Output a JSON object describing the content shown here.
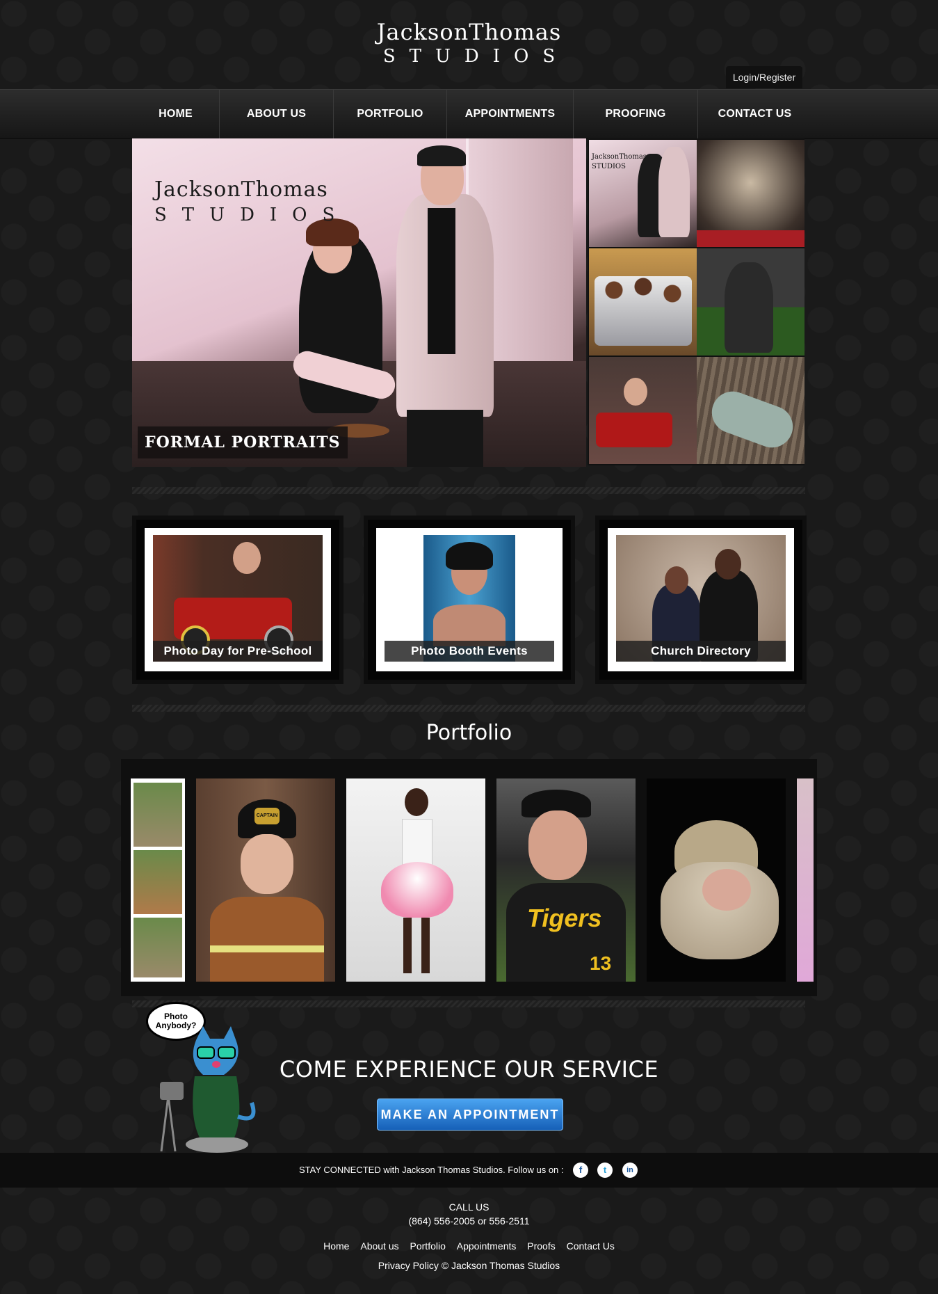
{
  "header": {
    "logo_line1": "JacksonThomas",
    "logo_line2": "STUDIOS",
    "login_label": "Login/Register"
  },
  "nav": {
    "items": [
      "HOME",
      "ABOUT US",
      "PORTFOLIO",
      "APPOINTMENTS",
      "PROOFING",
      "CONTACT US"
    ]
  },
  "hero": {
    "logo_line1": "JacksonThomas",
    "logo_line2": "STUDIOS",
    "caption": "FORMAL PORTRAITS",
    "thumb_logo": "JacksonThomas STUDIOS"
  },
  "features": [
    {
      "caption": "Photo Day for Pre-School"
    },
    {
      "caption": "Photo Booth Events"
    },
    {
      "caption": "Church Directory"
    }
  ],
  "portfolio": {
    "title": "Portfolio",
    "helmet_badge": "CAPTAIN",
    "jersey_text": "Tigers",
    "jersey_number": "13"
  },
  "cta": {
    "bubble": "Photo Anybody?",
    "headline": "COME EXPERIENCE OUR SERVICE",
    "button": "MAKE  AN  APPOINTMENT"
  },
  "social": {
    "text": "STAY CONNECTED with Jackson Thomas Studios. Follow us on :",
    "icons": [
      "f",
      "t",
      "in"
    ]
  },
  "footer": {
    "call_label": "CALL US",
    "phone": "(864) 556-2005 or 556-2511",
    "links": [
      "Home",
      "About us",
      "Portfolio",
      "Appointments",
      "Proofs",
      "Contact Us"
    ],
    "privacy": "Privacy Policy © Jackson Thomas Studios"
  }
}
